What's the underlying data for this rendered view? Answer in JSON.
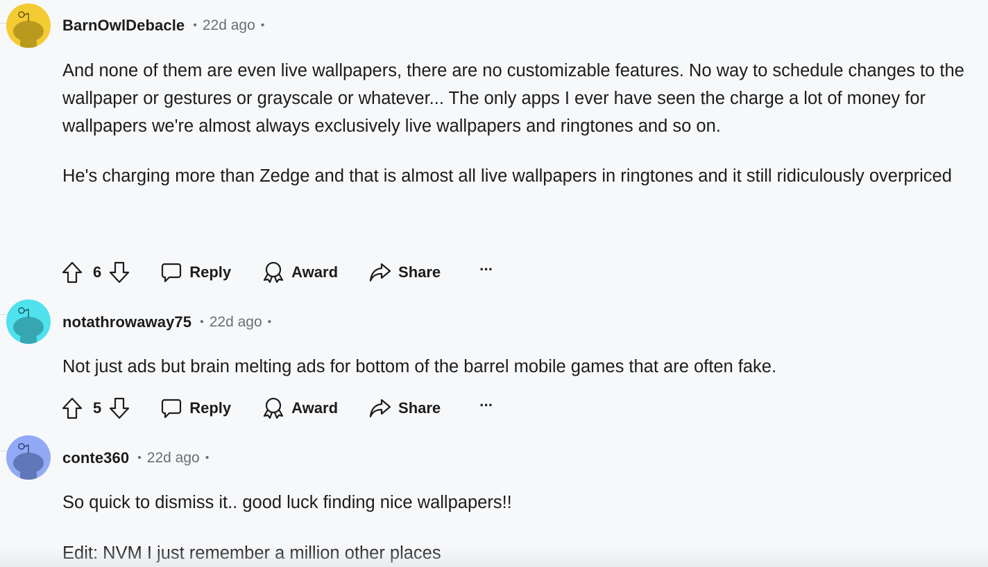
{
  "comments": [
    {
      "username": "BarnOwlDebacle",
      "time": "22d ago",
      "avatar_color": "#f5cb33",
      "avatar_figure_color": "#b99a1f",
      "paragraphs": [
        "And none of them are even live wallpapers, there are no customizable features.  No way to schedule changes to the wallpaper or gestures or grayscale or whatever... The only apps I ever have seen the charge a lot of money for wallpapers we're almost always exclusively live wallpapers and ringtones and so on.",
        "He's charging more than Zedge and that is almost all live wallpapers in ringtones and it still ridiculously overpriced"
      ],
      "score": "6",
      "reply_label": "Reply",
      "award_label": "Award",
      "share_label": "Share",
      "more_label": "···"
    },
    {
      "username": "notathrowaway75",
      "time": "22d ago",
      "avatar_color": "#4fe2ee",
      "avatar_figure_color": "#36a7b0",
      "paragraphs": [
        "Not just ads but brain melting ads for bottom of the barrel mobile games that are often fake."
      ],
      "score": "5",
      "reply_label": "Reply",
      "award_label": "Award",
      "share_label": "Share",
      "more_label": "···"
    },
    {
      "username": "conte360",
      "time": "22d ago",
      "avatar_color": "#92a9f5",
      "avatar_figure_color": "#6178b8",
      "paragraphs": [
        "So quick to dismiss it.. good luck finding nice wallpapers!!",
        "Edit: NVM I just remember a million other places"
      ]
    }
  ],
  "icons": {
    "upvote": "upvote-arrow-icon",
    "downvote": "downvote-arrow-icon",
    "reply": "speech-bubble-icon",
    "award": "award-ribbon-icon",
    "share": "share-arrow-icon"
  },
  "colors": {
    "background": "#f7f8fa",
    "text": "#1c1c1c",
    "meta": "#6a6f74"
  }
}
